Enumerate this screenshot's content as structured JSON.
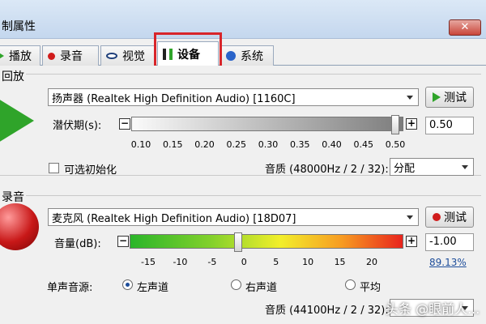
{
  "window": {
    "title": "制属性",
    "close_glyph": "✕"
  },
  "tabs": [
    {
      "label": "播放",
      "icon": "play-icon"
    },
    {
      "label": "录音",
      "icon": "record-icon"
    },
    {
      "label": "视觉",
      "icon": "eye-icon"
    },
    {
      "label": "设备",
      "icon": "device-icon",
      "active": true
    },
    {
      "label": "系统",
      "icon": "info-icon"
    }
  ],
  "playback": {
    "group_label": "回放",
    "device": "扬声器 (Realtek High Definition Audio) [1160C]",
    "test_label": "测试",
    "latency_label": "潜伏期(s):",
    "latency_value": "0.50",
    "latency_level": 1.0,
    "latency_ticks": [
      "0.10",
      "0.15",
      "0.20",
      "0.25",
      "0.30",
      "0.35",
      "0.40",
      "0.45",
      "0.50"
    ],
    "optional_init_label": "可选初始化",
    "quality_label": "音质 (48000Hz / 2 / 32):",
    "quality_value": "分配"
  },
  "recording": {
    "group_label": "录音",
    "device": "麦克风 (Realtek High Definition Audio) [18D07]",
    "test_label": "测试",
    "volume_label": "音量(dB):",
    "volume_value": "-1.00",
    "volume_percent": "89.13%",
    "volume_ticks": [
      "-15",
      "-10",
      "-5",
      "0",
      "5",
      "10",
      "15",
      "20"
    ],
    "mono_source_label": "单声音源:",
    "mono_options": [
      {
        "label": "左声道",
        "selected": true
      },
      {
        "label": "右声道",
        "selected": false
      },
      {
        "label": "平均",
        "selected": false
      }
    ],
    "quality_label": "音质 (44100Hz / 2 / 32):"
  },
  "watermark": "头条 @眼前人..."
}
